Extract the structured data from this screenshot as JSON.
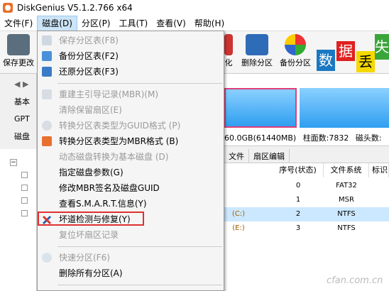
{
  "window": {
    "title": "DiskGenius V5.1.2.766 x64"
  },
  "menubar": [
    {
      "label": "文件(F)"
    },
    {
      "label": "磁盘(D)"
    },
    {
      "label": "分区(P)"
    },
    {
      "label": "工具(T)"
    },
    {
      "label": "查看(V)"
    },
    {
      "label": "帮助(H)"
    }
  ],
  "toolbar": {
    "save_label": "保存更改",
    "partial_label": "化",
    "delete_partition": "删除分区",
    "backup_partition": "备份分区",
    "ad_chars": [
      "数",
      "据",
      "丢",
      "失"
    ],
    "colors": {
      "ad_blue": "#1a78c2",
      "ad_red": "#e02020",
      "ad_green": "#3aa53a",
      "ad_yellow": "#f5d800"
    }
  },
  "left_panel": {
    "basic": "基本",
    "gpt": "GPT",
    "disk": "磁盘"
  },
  "disk_info": {
    "capacity": "60.0GB(61440MB)",
    "cylinders": "柱面数:7832",
    "heads": "磁头数:"
  },
  "tabs": [
    "文件",
    "扇区编辑"
  ],
  "table": {
    "headers": [
      "序号(状态)",
      "文件系统",
      "标识"
    ],
    "rows": [
      {
        "label": "",
        "index": "0",
        "fs": "FAT32"
      },
      {
        "label": "",
        "index": "1",
        "fs": "MSR"
      },
      {
        "label": "(C:)",
        "index": "2",
        "fs": "NTFS"
      },
      {
        "label": "(E:)",
        "index": "3",
        "fs": "NTFS"
      }
    ]
  },
  "dropdown": {
    "items": [
      {
        "label": "保存分区表(F8)",
        "disabled": true
      },
      {
        "label": "备份分区表(F2)",
        "disabled": false
      },
      {
        "label": "还原分区表(F3)",
        "disabled": false
      },
      {
        "label": "重建主引导记录(MBR)(M)",
        "disabled": true
      },
      {
        "label": "清除保留扇区(E)",
        "disabled": true
      },
      {
        "label": "转换分区表类型为GUID格式 (P)",
        "disabled": true
      },
      {
        "label": "转换分区表类型为MBR格式 (B)",
        "disabled": false
      },
      {
        "label": "动态磁盘转换为基本磁盘 (D)",
        "disabled": true
      },
      {
        "label": "指定磁盘参数(G)",
        "disabled": false
      },
      {
        "label": "修改MBR签名及磁盘GUID",
        "disabled": false
      },
      {
        "label": "查看S.M.A.R.T.信息(Y)",
        "disabled": false
      },
      {
        "label": "坏道检测与修复(Y)",
        "disabled": false
      },
      {
        "label": "复位坏扇区记录",
        "disabled": true
      },
      {
        "label": "快速分区(F6)",
        "disabled": true
      },
      {
        "label": "删除所有分区(A)",
        "disabled": false
      }
    ]
  },
  "watermark": "cfan.com.cn"
}
